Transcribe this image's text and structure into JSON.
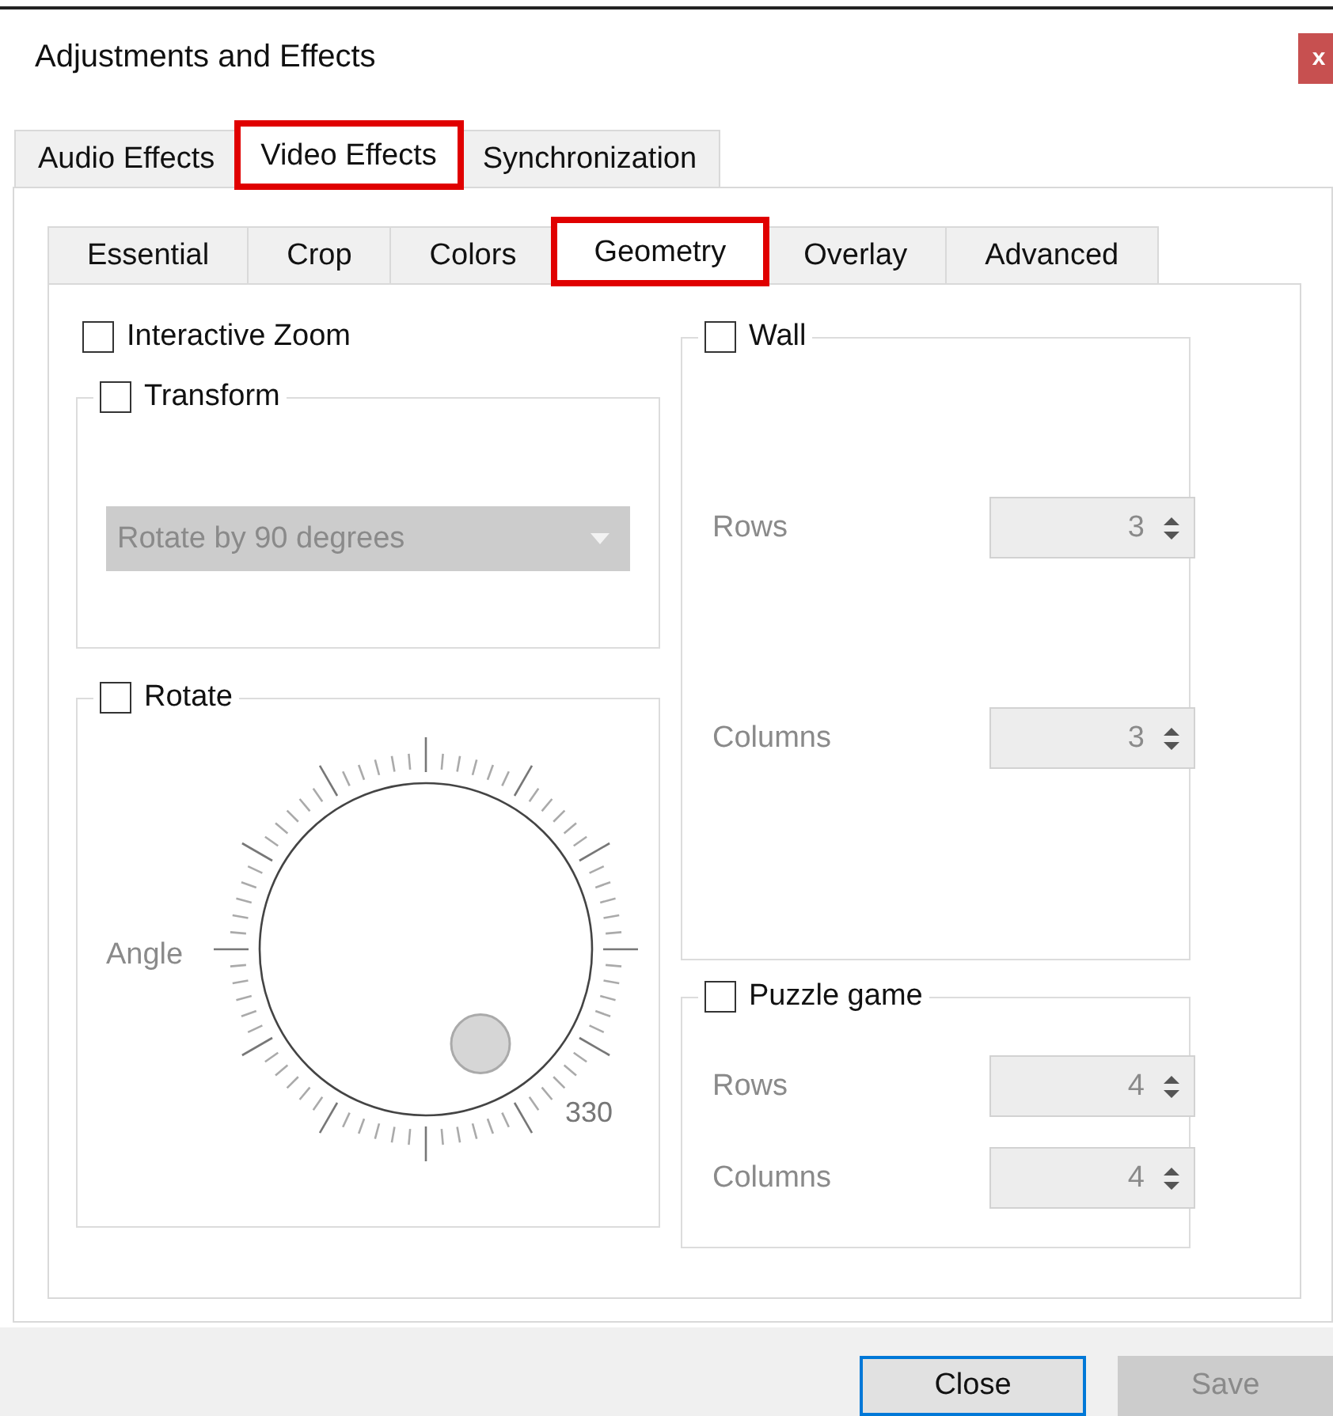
{
  "window": {
    "title": "Adjustments and Effects",
    "close": "x"
  },
  "tabs": [
    {
      "label": "Audio Effects",
      "selected": false,
      "highlighted": false
    },
    {
      "label": "Video Effects",
      "selected": true,
      "highlighted": true
    },
    {
      "label": "Synchronization",
      "selected": false,
      "highlighted": false
    }
  ],
  "subtabs": [
    {
      "label": "Essential",
      "selected": false,
      "highlighted": false
    },
    {
      "label": "Crop",
      "selected": false,
      "highlighted": false
    },
    {
      "label": "Colors",
      "selected": false,
      "highlighted": false
    },
    {
      "label": "Geometry",
      "selected": true,
      "highlighted": true
    },
    {
      "label": "Overlay",
      "selected": false,
      "highlighted": false
    },
    {
      "label": "Advanced",
      "selected": false,
      "highlighted": false
    }
  ],
  "interactive_zoom": {
    "label": "Interactive Zoom",
    "checked": false
  },
  "transform": {
    "label": "Transform",
    "checked": false,
    "dropdown": {
      "value": "Rotate by 90 degrees",
      "disabled": true
    }
  },
  "rotate": {
    "label": "Rotate",
    "checked": false,
    "angle_label": "Angle",
    "reading": "330"
  },
  "wall": {
    "label": "Wall",
    "checked": false,
    "fields": [
      {
        "label": "Rows",
        "value": "3",
        "disabled": true
      },
      {
        "label": "Columns",
        "value": "3",
        "disabled": true
      }
    ]
  },
  "puzzle": {
    "label": "Puzzle game",
    "checked": false,
    "fields": [
      {
        "label": "Rows",
        "value": "4",
        "disabled": true
      },
      {
        "label": "Columns",
        "value": "4",
        "disabled": true
      }
    ]
  },
  "buttons": [
    {
      "label": "Close",
      "disabled": false,
      "focused": true
    },
    {
      "label": "Save",
      "disabled": true,
      "focused": false
    }
  ]
}
